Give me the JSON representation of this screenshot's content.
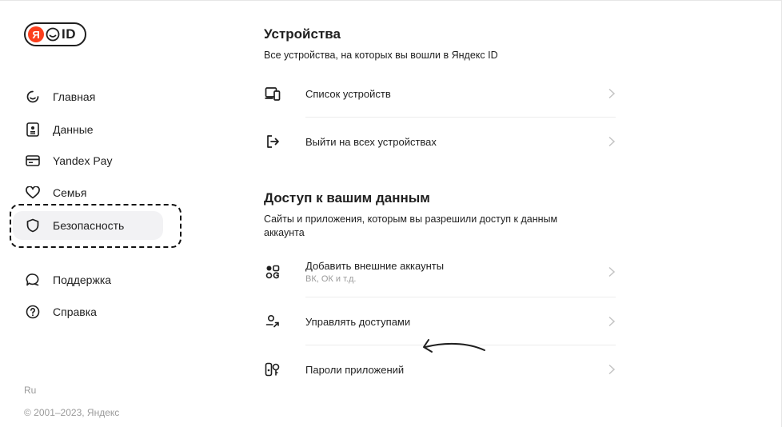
{
  "logo": {
    "ya_letter": "Я",
    "text": "ID"
  },
  "sidebar": {
    "items": [
      {
        "label": "Главная",
        "icon": "home-smile-icon"
      },
      {
        "label": "Данные",
        "icon": "id-card-icon"
      },
      {
        "label": "Yandex Pay",
        "icon": "card-icon"
      },
      {
        "label": "Семья",
        "icon": "heart-icon"
      },
      {
        "label": "Безопасность",
        "icon": "shield-icon",
        "active": true
      },
      {
        "label": "Поддержка",
        "icon": "chat-icon"
      },
      {
        "label": "Справка",
        "icon": "help-icon"
      }
    ]
  },
  "footer": {
    "lang": "Ru",
    "copyright": "© 2001–2023, Яндекс"
  },
  "devices": {
    "title": "Устройства",
    "subtitle": "Все устройства, на которых вы вошли в Яндекс ID",
    "rows": [
      {
        "label": "Список устройств",
        "icon": "devices-icon"
      },
      {
        "label": "Выйти на всех устройствах",
        "icon": "logout-icon"
      }
    ]
  },
  "access": {
    "title": "Доступ к вашим данным",
    "subtitle": "Сайты и приложения, которым вы разрешили доступ к данным аккаунта",
    "rows": [
      {
        "label": "Добавить внешние аккаунты",
        "hint": "ВК, ОК и т.д.",
        "icon": "external-accounts-icon"
      },
      {
        "label": "Управлять доступами",
        "icon": "user-access-icon"
      },
      {
        "label": "Пароли приложений",
        "icon": "app-passwords-icon"
      }
    ]
  },
  "colors": {
    "brand_red": "#fc3f1d",
    "active_bg": "#f2f2f4",
    "muted": "#9a9a9a"
  }
}
